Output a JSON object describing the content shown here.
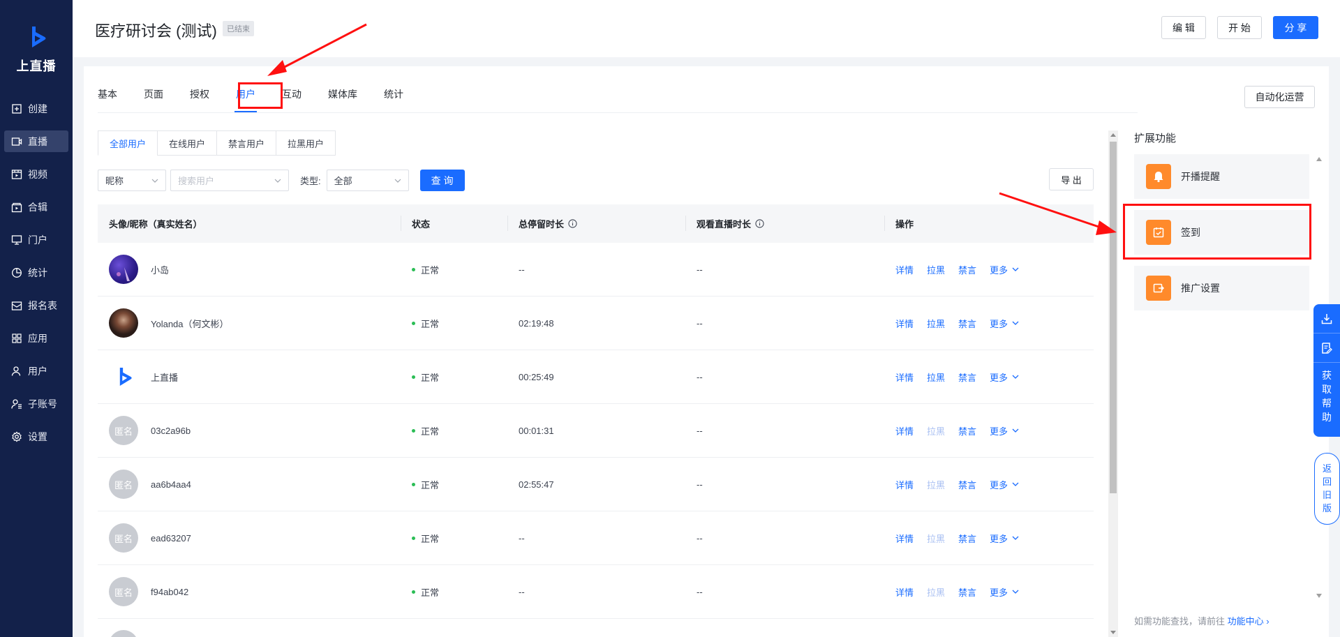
{
  "brand": {
    "name": "上直播"
  },
  "sidebar": {
    "items": [
      {
        "label": "创建",
        "icon": "plus-square-icon"
      },
      {
        "label": "直播",
        "icon": "live-camera-icon",
        "active": true
      },
      {
        "label": "视频",
        "icon": "video-icon"
      },
      {
        "label": "合辑",
        "icon": "collection-icon"
      },
      {
        "label": "门户",
        "icon": "monitor-icon"
      },
      {
        "label": "统计",
        "icon": "pie-chart-icon"
      },
      {
        "label": "报名表",
        "icon": "form-icon"
      },
      {
        "label": "应用",
        "icon": "apps-icon"
      },
      {
        "label": "用户",
        "icon": "user-icon"
      },
      {
        "label": "子账号",
        "icon": "sub-account-icon"
      },
      {
        "label": "设置",
        "icon": "gear-icon"
      }
    ]
  },
  "header": {
    "title": "医疗研讨会 (测试)",
    "status_badge": "已结束",
    "edit_label": "编 辑",
    "start_label": "开 始",
    "share_label": "分 享"
  },
  "tabs": [
    "基本",
    "页面",
    "授权",
    "用户",
    "互动",
    "媒体库",
    "统计"
  ],
  "active_tab": "用户",
  "automation_label": "自动化运营",
  "subtabs": [
    "全部用户",
    "在线用户",
    "禁言用户",
    "拉黑用户"
  ],
  "filters": {
    "field_select": "昵称",
    "search_placeholder": "搜索用户",
    "type_label": "类型:",
    "type_select": "全部",
    "query_label": "查 询",
    "export_label": "导 出"
  },
  "table": {
    "headers": [
      "头像/昵称（真实姓名）",
      "状态",
      "总停留时长",
      "观看直播时长",
      "操作"
    ],
    "ops": {
      "detail": "详情",
      "block": "拉黑",
      "mute": "禁言",
      "more": "更多"
    },
    "rows": [
      {
        "name": "小岛",
        "avatar": "photo-purple",
        "status": "正常",
        "stay": "--",
        "watch": "--",
        "block_enabled": true
      },
      {
        "name": "Yolanda（何文彬）",
        "avatar": "photo-portrait",
        "status": "正常",
        "stay": "02:19:48",
        "watch": "--",
        "block_enabled": true
      },
      {
        "name": "上直播",
        "avatar": "brand-logo",
        "status": "正常",
        "stay": "00:25:49",
        "watch": "--",
        "block_enabled": true
      },
      {
        "name": "03c2a96b",
        "avatar": "anon",
        "avatar_text": "匿名",
        "status": "正常",
        "stay": "00:01:31",
        "watch": "--",
        "block_enabled": false
      },
      {
        "name": "aa6b4aa4",
        "avatar": "anon",
        "avatar_text": "匿名",
        "status": "正常",
        "stay": "02:55:47",
        "watch": "--",
        "block_enabled": false
      },
      {
        "name": "ead63207",
        "avatar": "anon",
        "avatar_text": "匿名",
        "status": "正常",
        "stay": "--",
        "watch": "--",
        "block_enabled": false
      },
      {
        "name": "f94ab042",
        "avatar": "anon",
        "avatar_text": "匿名",
        "status": "正常",
        "stay": "--",
        "watch": "--",
        "block_enabled": false
      }
    ]
  },
  "extensions": {
    "title": "扩展功能",
    "items": [
      {
        "label": "开播提醒",
        "icon": "bell-icon"
      },
      {
        "label": "签到",
        "icon": "checkin-icon"
      },
      {
        "label": "推广设置",
        "icon": "share-out-icon"
      }
    ],
    "note_prefix": "如需功能查找，请前往",
    "note_link": "功能中心 ›"
  },
  "help": {
    "text": "获取帮助"
  },
  "old_version": {
    "text": "返回旧版"
  },
  "colors": {
    "primary": "#1a6cff",
    "sidebar": "#13214a",
    "annotation": "#ff1010",
    "accent_orange": "#ff8a2b"
  }
}
